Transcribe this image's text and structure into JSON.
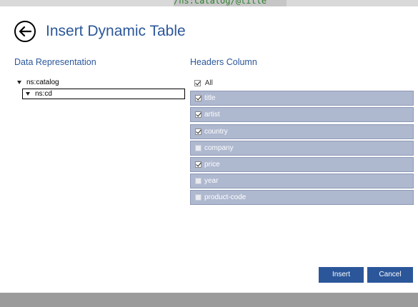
{
  "background_title": "/ns:catalog/@title",
  "dialog": {
    "title": "Insert Dynamic Table",
    "back_icon": "back-arrow-icon",
    "accent_color": "#2b579a"
  },
  "data_representation": {
    "label": "Data Representation",
    "tree": [
      {
        "label": "ns:catalog",
        "expanded": true
      },
      {
        "label": "ns:cd",
        "expanded": true,
        "selected": true
      }
    ]
  },
  "headers_column": {
    "label": "Headers Column",
    "all": {
      "label": "All",
      "checked": true
    },
    "rows": [
      {
        "label": "title",
        "checked": true
      },
      {
        "label": "artist",
        "checked": true
      },
      {
        "label": "country",
        "checked": true
      },
      {
        "label": "company",
        "checked": false
      },
      {
        "label": "price",
        "checked": true
      },
      {
        "label": "year",
        "checked": false
      },
      {
        "label": "product-code",
        "checked": false
      }
    ]
  },
  "buttons": {
    "insert": "Insert",
    "cancel": "Cancel"
  }
}
